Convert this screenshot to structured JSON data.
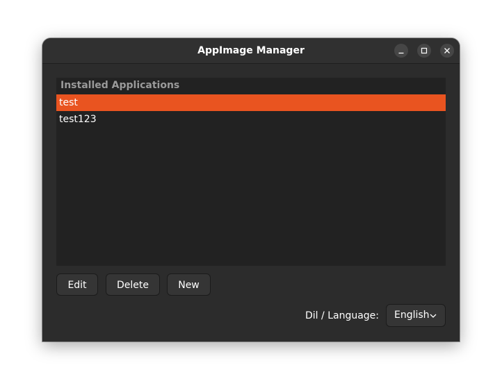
{
  "window": {
    "title": "AppImage Manager"
  },
  "list": {
    "header": "Installed Applications",
    "items": [
      "test",
      "test123"
    ],
    "selected_index": 0
  },
  "buttons": {
    "edit": "Edit",
    "delete": "Delete",
    "new": "New"
  },
  "language": {
    "label": "Dil / Language:",
    "selected": "English"
  },
  "colors": {
    "accent": "#e95420",
    "window_bg": "#2c2c2c",
    "list_bg": "#222222"
  },
  "icons": {
    "minimize": "minimize-icon",
    "maximize": "maximize-icon",
    "close": "close-icon",
    "dropdown": "chevron-down-icon"
  }
}
